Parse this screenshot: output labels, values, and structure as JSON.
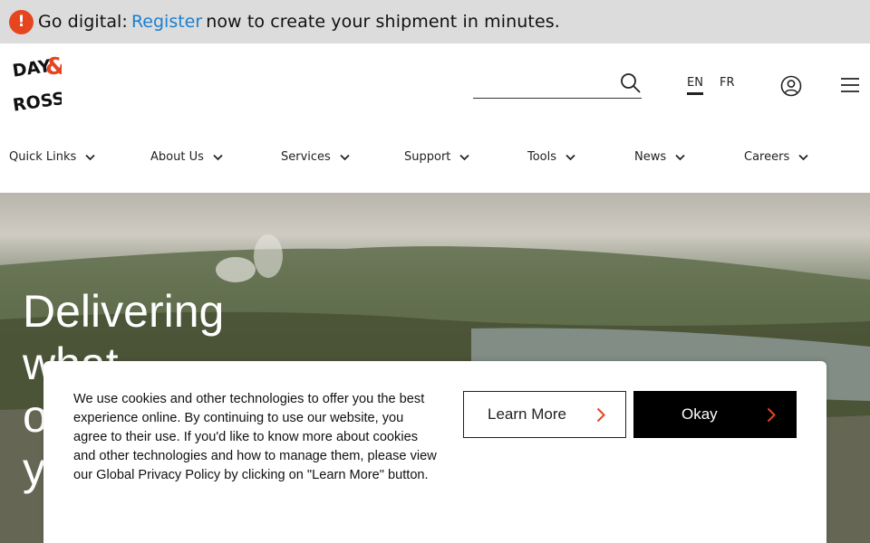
{
  "announcement": {
    "prefix": "Go digital:",
    "link": "Register",
    "suffix": "now to create your shipment in minutes.",
    "icon": "alert-icon",
    "alert_color": "#e5451f"
  },
  "header": {
    "logo_text": [
      "DAY",
      "&",
      "ROSS"
    ],
    "search": {
      "placeholder": "",
      "value": ""
    },
    "languages": [
      "EN",
      "FR"
    ],
    "active_language": "EN"
  },
  "nav": {
    "items": [
      {
        "label": "Quick Links"
      },
      {
        "label": "About Us"
      },
      {
        "label": "Services"
      },
      {
        "label": "Support"
      },
      {
        "label": "Tools"
      },
      {
        "label": "News"
      },
      {
        "label": "Careers"
      }
    ]
  },
  "hero": {
    "title_lines": [
      "Delivering",
      "what",
      "o",
      "y"
    ]
  },
  "cookie": {
    "text": "We use cookies and other technologies to offer you the best experience online. By continuing to use our website, you agree to their use. If you'd like to know more about cookies and other technologies and how to manage them, please view our Global Privacy Policy by clicking on \"Learn More\" button.",
    "learn_more_label": "Learn More",
    "okay_label": "Okay",
    "accent_color": "#e5451f"
  }
}
